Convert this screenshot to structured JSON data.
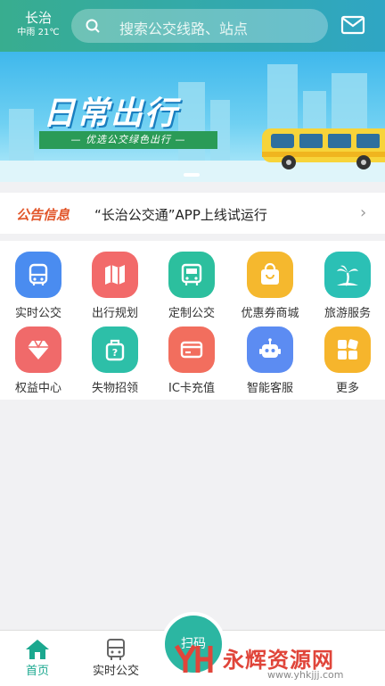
{
  "header": {
    "city": "长治",
    "weather": "中雨 21℃",
    "search_placeholder": "搜索公交线路、站点"
  },
  "banner": {
    "title": "日常出行",
    "subtitle": "— 优选公交绿色出行 —"
  },
  "notice": {
    "tag": "公告信息",
    "text": "“长治公交通”APP上线试运行"
  },
  "grid": [
    {
      "label": "实时公交",
      "color": "#4a8cf0",
      "icon": "bus-icon"
    },
    {
      "label": "出行规划",
      "color": "#f26a6a",
      "icon": "map-icon"
    },
    {
      "label": "定制公交",
      "color": "#2cbf9e",
      "icon": "custom-bus-icon"
    },
    {
      "label": "优惠券商城",
      "color": "#f5b82e",
      "icon": "shopping-bag-icon"
    },
    {
      "label": "旅游服务",
      "color": "#2bc0b5",
      "icon": "palm-tree-icon"
    },
    {
      "label": "权益中心",
      "color": "#f06a6a",
      "icon": "diamond-icon"
    },
    {
      "label": "失物招领",
      "color": "#2dbfa8",
      "icon": "luggage-icon"
    },
    {
      "label": "IC卡充值",
      "color": "#f26e5e",
      "icon": "card-icon"
    },
    {
      "label": "智能客服",
      "color": "#5c8cf2",
      "icon": "robot-icon"
    },
    {
      "label": "更多",
      "color": "#f6b52c",
      "icon": "more-grid-icon"
    }
  ],
  "tabbar": {
    "home": "首页",
    "realtime": "实时公交",
    "scan": "扫码"
  },
  "watermark": {
    "title": "永辉资源网",
    "url": "www.yhkjjj.com"
  }
}
